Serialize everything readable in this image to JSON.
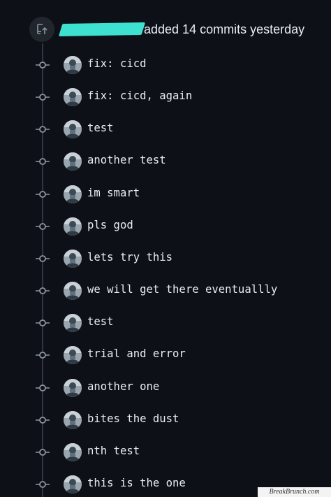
{
  "header": {
    "icon": "repo-push-icon",
    "author_redacted": true,
    "action_text": "added 14 commits yesterday"
  },
  "commits": [
    {
      "message": "fix: cicd"
    },
    {
      "message": "fix: cicd, again"
    },
    {
      "message": "test"
    },
    {
      "message": "another test"
    },
    {
      "message": "im smart"
    },
    {
      "message": "pls god"
    },
    {
      "message": "lets try this"
    },
    {
      "message": "we will get there eventuallly"
    },
    {
      "message": "test"
    },
    {
      "message": "trial and error"
    },
    {
      "message": "another one"
    },
    {
      "message": "bites the dust"
    },
    {
      "message": "nth test"
    },
    {
      "message": "this is the one"
    }
  ],
  "watermark": {
    "text": "BreakBrunch.com"
  },
  "colors": {
    "background": "#0d1117",
    "timeline": "#30363d",
    "text": "#e6edf3",
    "redaction": "#3ee0cf"
  }
}
